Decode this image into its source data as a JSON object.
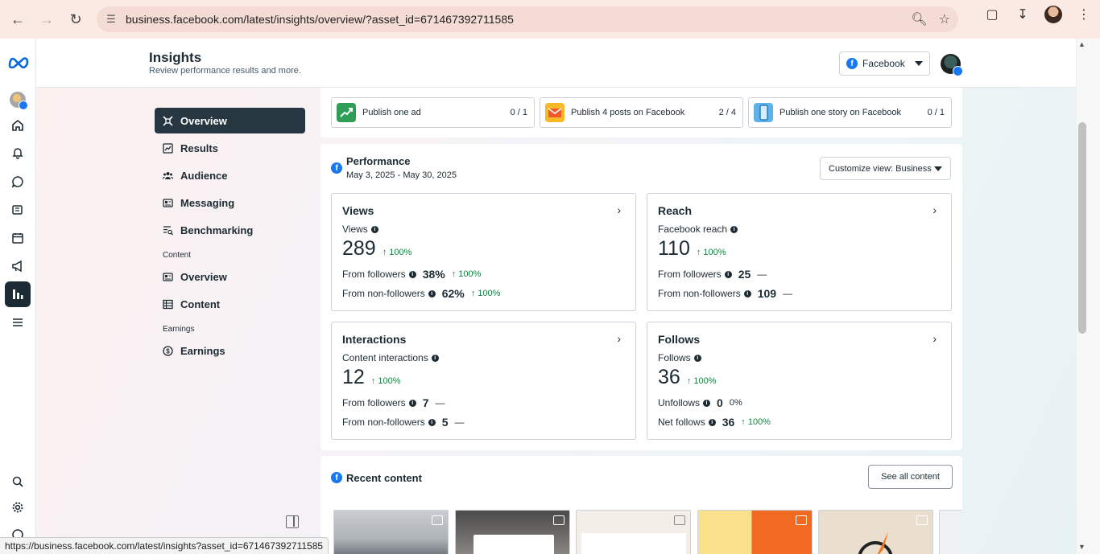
{
  "browser": {
    "url": "business.facebook.com/latest/insights/overview/?asset_id=671467392711585",
    "status_url": "https://business.facebook.com/latest/insights?asset_id=671467392711585"
  },
  "header": {
    "title": "Insights",
    "subtitle": "Review performance results and more.",
    "platform_select": "Facebook"
  },
  "nav": {
    "items": [
      {
        "label": "Overview",
        "icon": "overview-icon"
      },
      {
        "label": "Results",
        "icon": "results-icon"
      },
      {
        "label": "Audience",
        "icon": "audience-icon"
      },
      {
        "label": "Messaging",
        "icon": "messaging-icon"
      },
      {
        "label": "Benchmarking",
        "icon": "benchmarking-icon"
      }
    ],
    "content_section": "Content",
    "content_items": [
      {
        "label": "Overview"
      },
      {
        "label": "Content"
      }
    ],
    "earnings_section": "Earnings",
    "earnings_items": [
      {
        "label": "Earnings"
      }
    ]
  },
  "goals": [
    {
      "label": "Publish one ad",
      "count": "0 / 1",
      "color": "#2e9d55"
    },
    {
      "label": "Publish 4 posts on Facebook",
      "count": "2 / 4",
      "color": "#f7b928"
    },
    {
      "label": "Publish one story on Facebook",
      "count": "0 / 1",
      "color": "#5fb2e8"
    }
  ],
  "performance": {
    "title": "Performance",
    "dates": "May 3, 2025 - May 30, 2025",
    "customize_label": "Customize view: Business",
    "cards": {
      "views": {
        "title": "Views",
        "metric_label": "Views",
        "value": "289",
        "delta": "100%",
        "rows": [
          {
            "label": "From followers",
            "value": "38%",
            "delta": "100%"
          },
          {
            "label": "From non-followers",
            "value": "62%",
            "delta": "100%"
          }
        ]
      },
      "reach": {
        "title": "Reach",
        "metric_label": "Facebook reach",
        "value": "110",
        "delta": "100%",
        "rows": [
          {
            "label": "From followers",
            "value": "25",
            "delta": "—"
          },
          {
            "label": "From non-followers",
            "value": "109",
            "delta": "—"
          }
        ]
      },
      "interactions": {
        "title": "Interactions",
        "metric_label": "Content interactions",
        "value": "12",
        "delta": "100%",
        "rows": [
          {
            "label": "From followers",
            "value": "7",
            "delta": "—"
          },
          {
            "label": "From non-followers",
            "value": "5",
            "delta": "—"
          }
        ]
      },
      "follows": {
        "title": "Follows",
        "metric_label": "Follows",
        "value": "36",
        "delta": "100%",
        "rows": [
          {
            "label": "Unfollows",
            "value": "0",
            "delta": "0%"
          },
          {
            "label": "Net follows",
            "value": "36",
            "delta": "100%"
          }
        ]
      }
    }
  },
  "recent": {
    "title": "Recent content",
    "see_all": "See all content"
  },
  "colors": {
    "accent": "#1877f2",
    "nav_active": "#263742",
    "positive": "#1a7f45"
  }
}
